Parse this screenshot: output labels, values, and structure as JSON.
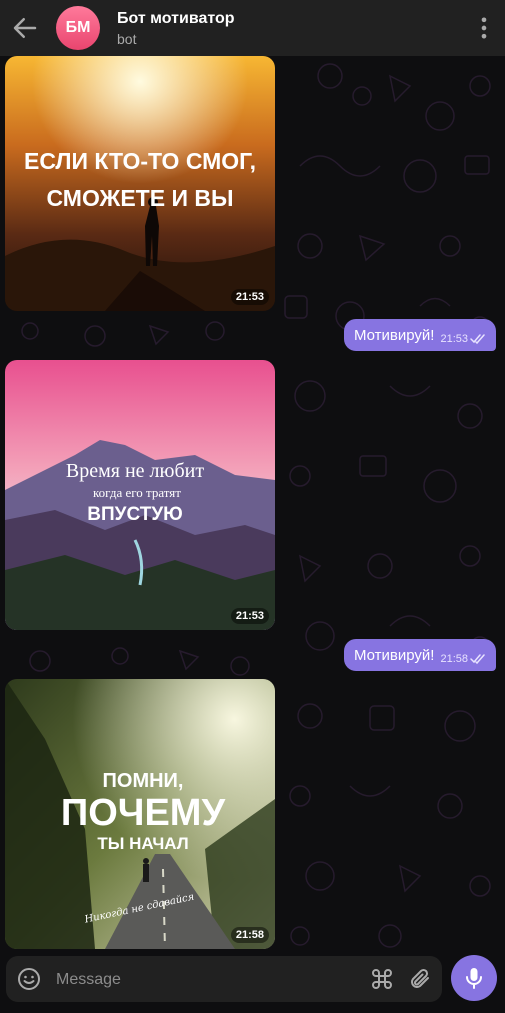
{
  "header": {
    "title": "Бот мотиватор",
    "subtitle": "bot",
    "avatar_initials": "БМ"
  },
  "messages": [
    {
      "kind": "photo",
      "caption": [
        "ЕСЛИ КТО-ТО СМОГ,",
        "СМОЖЕТЕ И ВЫ"
      ],
      "time": "21:53"
    },
    {
      "kind": "outgoing",
      "text": "Мотивируй!",
      "time": "21:53",
      "status": "read"
    },
    {
      "kind": "photo",
      "caption": [
        "Время не любит",
        "когда его тратят",
        "ВПУСТУЮ"
      ],
      "time": "21:53"
    },
    {
      "kind": "outgoing",
      "text": "Мотивируй!",
      "time": "21:58",
      "status": "read"
    },
    {
      "kind": "photo",
      "caption": [
        "ПОМНИ,",
        "ПОЧЕМУ",
        "ТЫ НАЧАЛ"
      ],
      "signature": "Никогда не сдавайся",
      "time": "21:58"
    }
  ],
  "composer": {
    "placeholder": "Message"
  },
  "colors": {
    "accent": "#8774e1",
    "header_bg": "#212121",
    "chat_bg": "#0e0e10"
  },
  "icons": [
    "back-arrow-icon",
    "more-vertical-icon",
    "emoji-icon",
    "command-icon",
    "paperclip-icon",
    "microphone-icon",
    "double-check-icon"
  ]
}
